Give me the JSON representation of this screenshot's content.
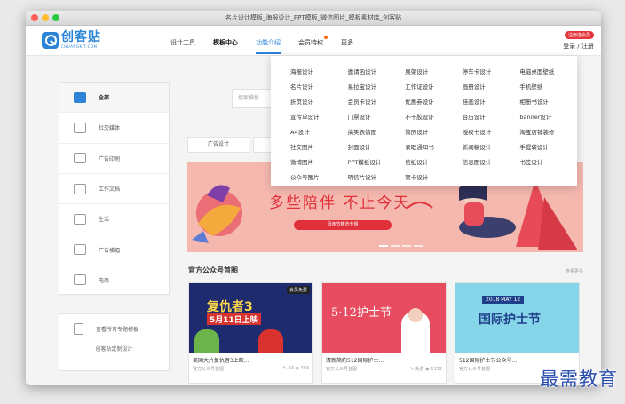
{
  "window": {
    "title": "名片设计模板_海报设计_PPT模板_微信图片_模板素材库_创客贴"
  },
  "logo": {
    "name": "创客贴",
    "sub": "CHUANGKIT.COM"
  },
  "nav": {
    "items": [
      "设计工具",
      "模板中心",
      "功能介绍",
      "会员特权",
      "更多"
    ]
  },
  "header": {
    "vip_badge": "注册送会员",
    "auth": "登录 / 注册"
  },
  "search": {
    "placeholder": "搜索模板"
  },
  "sidebar": {
    "items": [
      {
        "label": "全部",
        "icon": "home-icon"
      },
      {
        "label": "社交媒体",
        "icon": "social-icon"
      },
      {
        "label": "广告印刷",
        "icon": "print-icon"
      },
      {
        "label": "工作文档",
        "icon": "document-icon"
      },
      {
        "label": "生活",
        "icon": "coffee-icon"
      },
      {
        "label": "广告横幅",
        "icon": "banner-icon"
      },
      {
        "label": "电商",
        "icon": "shop-icon"
      }
    ],
    "all_topics": "查看所有专题模板",
    "custom": "创客贴定制设计"
  },
  "tabs": [
    "广告设计",
    "",
    "",
    ""
  ],
  "banner": {
    "headline": "多些陪伴 不止今天",
    "sub": "母亲节精选专题"
  },
  "section": {
    "title": "官方公众号首图",
    "more": "查看更多"
  },
  "cards": [
    {
      "title": "美国大片复仇者3上映...",
      "source": "官方公众号首图",
      "img_text": "复仇者3",
      "img_sub": "5月11日上映",
      "tag": "会员免费",
      "stat1": "93",
      "stat2": "493"
    },
    {
      "title": "清新简约512国际护士...",
      "source": "官方公众号首图",
      "img_text": "5·12护士节",
      "tag": "",
      "stat1": "免费",
      "stat2": "1372"
    },
    {
      "title": "512国际护士节公众号...",
      "source": "官方公众号首图",
      "img_text": "国际护士节",
      "img_sub": "2018 MAY 12",
      "tag": "",
      "stat1": "",
      "stat2": ""
    }
  ],
  "dropdown": {
    "items": [
      "海报设计",
      "邀请函设计",
      "展架设计",
      "停车卡设计",
      "电脑桌面壁纸",
      "名片设计",
      "易拉宝设计",
      "工作证设计",
      "画册设计",
      "手机壁纸",
      "折页设计",
      "会员卡设计",
      "优惠券设计",
      "挂画设计",
      "相册书设计",
      "宣传单设计",
      "门票设计",
      "不干胶设计",
      "台历设计",
      "banner设计",
      "A4设计",
      "搞笑表情图",
      "简历设计",
      "授权书设计",
      "淘宝店铺装修",
      "社交图片",
      "封面设计",
      "录取通知书",
      "新闻稿设计",
      "手提袋设计",
      "微博图片",
      "PPT模板设计",
      "信纸设计",
      "信息图设计",
      "书签设计",
      "公众号图片",
      "明信片设计",
      "贺卡设计",
      "",
      ""
    ]
  },
  "watermark": "最需教育",
  "colors": {
    "brand": "#2b84d8",
    "accent_red": "#e4353c"
  }
}
